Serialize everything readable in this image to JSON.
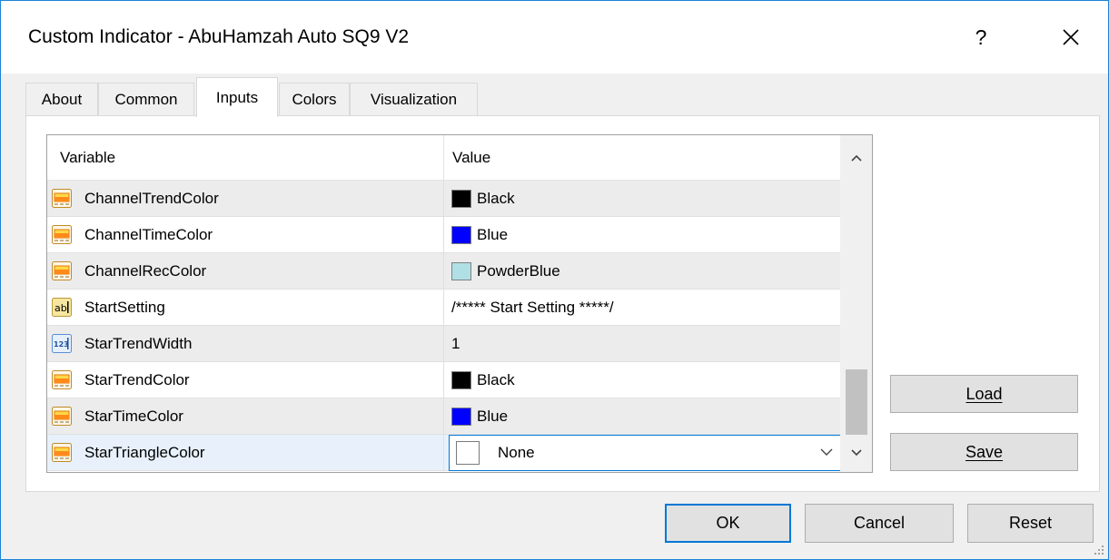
{
  "window": {
    "title": "Custom Indicator - AbuHamzah Auto SQ9 V2",
    "help_label": "?",
    "close_label": "✕"
  },
  "tabs": [
    {
      "label": "About",
      "active": false
    },
    {
      "label": "Common",
      "active": false
    },
    {
      "label": "Inputs",
      "active": true
    },
    {
      "label": "Colors",
      "active": false
    },
    {
      "label": "Visualization",
      "active": false
    }
  ],
  "grid": {
    "columns": {
      "variable": "Variable",
      "value": "Value"
    },
    "rows": [
      {
        "variable": "ChannelTrendColor",
        "type_icon": "color-icon",
        "value": "Black",
        "swatch": "#000000"
      },
      {
        "variable": "ChannelTimeColor",
        "type_icon": "color-icon",
        "value": "Blue",
        "swatch": "#0000ff"
      },
      {
        "variable": "ChannelRecColor",
        "type_icon": "color-icon",
        "value": "PowderBlue",
        "swatch": "#b0e0e6"
      },
      {
        "variable": "StartSetting",
        "type_icon": "string-icon",
        "value": "/***** Start Setting *****/",
        "swatch": null
      },
      {
        "variable": "StarTrendWidth",
        "type_icon": "integer-icon",
        "value": "1",
        "swatch": null
      },
      {
        "variable": "StarTrendColor",
        "type_icon": "color-icon",
        "value": "Black",
        "swatch": "#000000"
      },
      {
        "variable": "StarTimeColor",
        "type_icon": "color-icon",
        "value": "Blue",
        "swatch": "#0000ff"
      },
      {
        "variable": "StarTriangleColor",
        "type_icon": "color-icon",
        "value": "None",
        "swatch": "#ffffff"
      }
    ]
  },
  "buttons": {
    "load": "Load",
    "save": "Save",
    "ok": "OK",
    "cancel": "Cancel",
    "reset": "Reset"
  },
  "colors": {
    "accent": "#0078d7",
    "alt_row": "#ececec",
    "selected_row": "#e8f1fb"
  }
}
